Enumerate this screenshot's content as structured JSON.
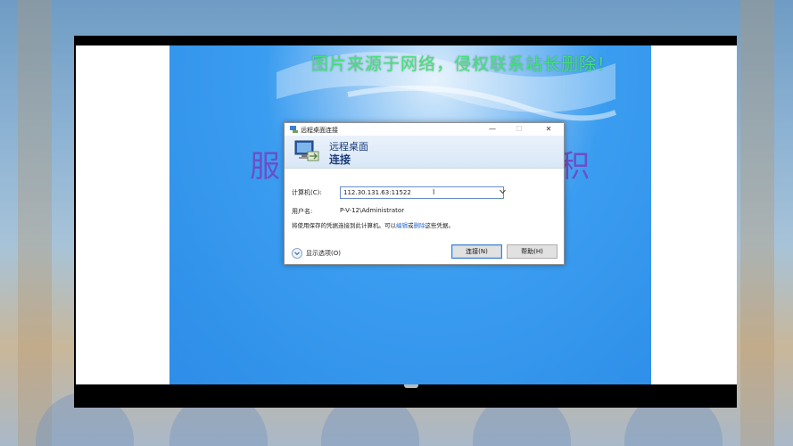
{
  "watermark": "图片来源于网络，侵权联系站长删除！",
  "background_chars": [
    "服",
    "积"
  ],
  "dialog": {
    "title": "远程桌面连接",
    "header_line1": "远程桌面",
    "header_line2": "连接",
    "computer_label": "计算机(C):",
    "computer_value": "112.30.131.63:11522",
    "username_label": "用户名:",
    "username_value": "P-V-12\\Administrator",
    "info_prefix": "将使用保存的凭据连接到此计算机。可以",
    "info_edit": "编辑",
    "info_mid": "或",
    "info_delete": "删除",
    "info_suffix": "这些凭据。",
    "show_options": "显示选项(O)",
    "connect_button": "连接(N)",
    "help_button": "帮助(H)",
    "minimize": "—",
    "maximize": "☐",
    "close": "✕"
  },
  "colors": {
    "accent": "#2a6bd3",
    "watermark": "#44e07a",
    "desktop": "#3b9df0"
  }
}
